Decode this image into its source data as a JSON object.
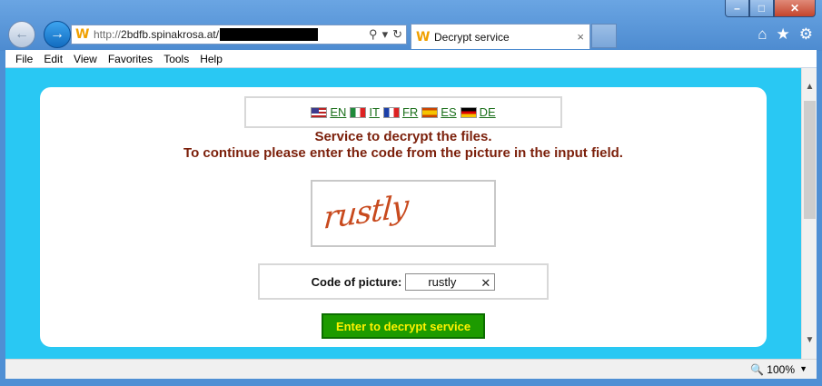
{
  "window": {
    "minimize_glyph": "–",
    "maximize_glyph": "□",
    "close_glyph": "✕"
  },
  "nav": {
    "back_glyph": "←",
    "forward_glyph": "→"
  },
  "address": {
    "protocol": "http://",
    "host": "2bdfb.spinakrosa.at/",
    "search_glyph": "⚲",
    "dropdown_glyph": "▾",
    "refresh_glyph": "↻"
  },
  "tab": {
    "title": "Decrypt service",
    "close_glyph": "×"
  },
  "toolbar_icons": {
    "home": "⌂",
    "favorites": "★",
    "settings": "⚙"
  },
  "favicon_glyph": "W",
  "menu": [
    "File",
    "Edit",
    "View",
    "Favorites",
    "Tools",
    "Help"
  ],
  "languages": [
    {
      "code": "EN",
      "label": "EN"
    },
    {
      "code": "IT",
      "label": "IT"
    },
    {
      "code": "FR",
      "label": "FR"
    },
    {
      "code": "ES",
      "label": "ES"
    },
    {
      "code": "DE",
      "label": "DE"
    }
  ],
  "page": {
    "line1": "Service to decrypt the files.",
    "line2": "To continue please enter the code from the picture in the input field.",
    "captcha_text": "rustly",
    "code_label": "Code of picture:",
    "code_value": "rustly",
    "clear_glyph": "✕",
    "submit_label": "Enter to decrypt service"
  },
  "status": {
    "zoom": "100%",
    "zoom_icon": "🔍",
    "zoom_caret": "▼"
  },
  "scroll": {
    "up": "▲",
    "down": "▼"
  },
  "colors": {
    "page_background": "#29c8f3",
    "headline": "#7b1f0a",
    "button_bg": "#1d9b00",
    "button_text": "#fff200",
    "lang_link": "#1a6f1a"
  }
}
